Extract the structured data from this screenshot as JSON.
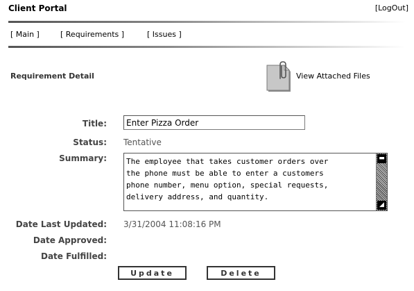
{
  "header": {
    "app_title": "Client Portal",
    "logout_label": "[LogOut]"
  },
  "nav": {
    "items": [
      {
        "label": "[ Main ]"
      },
      {
        "label": "[ Requirements ]"
      },
      {
        "label": "[ Issues ]"
      }
    ]
  },
  "section": {
    "title": "Requirement Detail",
    "attach_label": "View Attached Files",
    "attach_icon": "paperclip-document-icon"
  },
  "form": {
    "title_label": "Title:",
    "title_value": "Enter Pizza Order",
    "status_label": "Status:",
    "status_value": "Tentative",
    "summary_label": "Summary:",
    "summary_value": "The employee that takes customer orders over\nthe phone must be able to enter a customers\nphone number, menu option, special requests,\ndelivery address, and quantity.",
    "date_updated_label": "Date Last Updated:",
    "date_updated_value": "3/31/2004 11:08:16 PM",
    "date_approved_label": "Date Approved:",
    "date_approved_value": "",
    "date_fulfilled_label": "Date Fulfilled:",
    "date_fulfilled_value": ""
  },
  "actions": {
    "update_label": "Update",
    "delete_label": "Delete"
  }
}
